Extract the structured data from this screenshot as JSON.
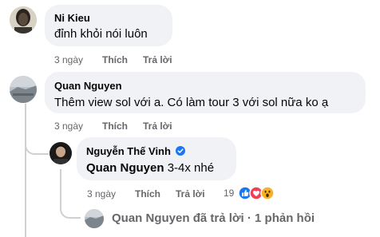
{
  "comments": [
    {
      "author": "Ni Kieu",
      "text": "đỉnh khỏi nói luôn",
      "time": "3 ngày",
      "like": "Thích",
      "reply": "Trả lời"
    },
    {
      "author": "Quan Nguyen",
      "text": "Thêm view sol với a. Có làm tour 3 với sol nữa ko ạ",
      "time": "3 ngày",
      "like": "Thích",
      "reply": "Trả lời"
    }
  ],
  "reply": {
    "author": "Nguyễn Thế Vinh",
    "verified_icon": "verified-badge-icon",
    "mention": "Quan Nguyen",
    "text": "3-4x nhé",
    "time": "3 ngày",
    "like": "Thích",
    "reply": "Trả lời",
    "reaction_count": "19",
    "reaction_icons": [
      "like-reaction-icon",
      "love-reaction-icon",
      "wow-reaction-icon"
    ]
  },
  "more_replies": {
    "author": "Quan Nguyen",
    "action": "đã trả lời",
    "separator": "·",
    "count": "1 phản hồi"
  },
  "colors": {
    "bubble": "#f0f2f5",
    "meta": "#65676b",
    "like_blue": "#1877f2",
    "love_red": "#f33e58",
    "wow_yellow": "#f7b125"
  }
}
